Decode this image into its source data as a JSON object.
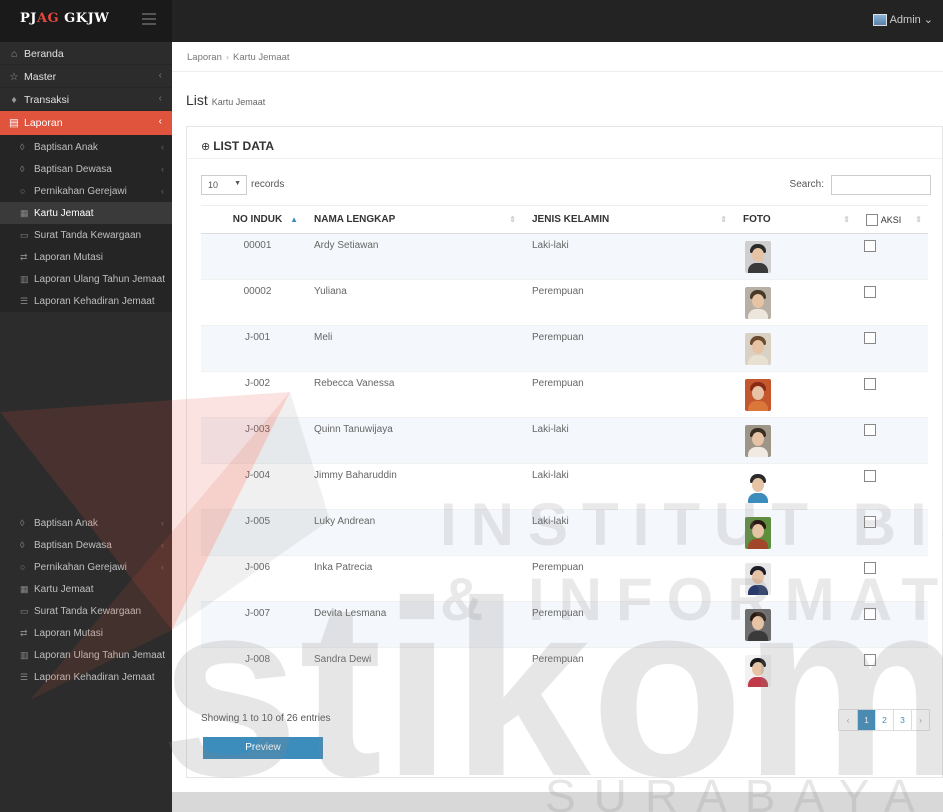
{
  "app": {
    "brand_prefix": "PJ",
    "brand_accent": "AG",
    "brand_suffix": " GKJW",
    "user": "Admin",
    "accent_color": "#e0533d",
    "primary_color": "#3c8dbc"
  },
  "sidebar": {
    "items": [
      {
        "label": "Beranda",
        "icon": "home-icon"
      },
      {
        "label": "Master",
        "icon": "star-icon"
      },
      {
        "label": "Transaksi",
        "icon": "diamond-icon"
      },
      {
        "label": "Laporan",
        "icon": "report-icon"
      }
    ],
    "sub_items": [
      {
        "label": "Baptisan Anak"
      },
      {
        "label": "Baptisan Dewasa"
      },
      {
        "label": "Pernikahan Gerejawi"
      },
      {
        "label": "Kartu Jemaat"
      },
      {
        "label": "Surat Tanda Kewargaan"
      },
      {
        "label": "Laporan Mutasi"
      },
      {
        "label": "Laporan Ulang Tahun Jemaat"
      },
      {
        "label": "Laporan Kehadiran Jemaat"
      }
    ]
  },
  "breadcrumb": {
    "parent": "Laporan",
    "current": "Kartu Jemaat"
  },
  "page": {
    "title": "List",
    "subtitle": "Kartu Jemaat"
  },
  "box": {
    "title": "LIST DATA"
  },
  "controls": {
    "length_value": "10",
    "length_label": "records",
    "search_label": "Search:",
    "search_value": ""
  },
  "table": {
    "headers": {
      "no": "NO INDUK",
      "name": "NAMA LENGKAP",
      "gender": "JENIS KELAMIN",
      "photo": "FOTO",
      "action": "AKSI"
    },
    "rows": [
      {
        "no": "00001",
        "name": "Ardy Setiawan",
        "gender": "Laki-laki"
      },
      {
        "no": "00002",
        "name": "Yuliana",
        "gender": "Perempuan"
      },
      {
        "no": "J-001",
        "name": "Meli",
        "gender": "Perempuan"
      },
      {
        "no": "J-002",
        "name": "Rebecca Vanessa",
        "gender": "Perempuan"
      },
      {
        "no": "J-003",
        "name": "Quinn Tanuwijaya",
        "gender": "Laki-laki"
      },
      {
        "no": "J-004",
        "name": "Jimmy Baharuddin",
        "gender": "Laki-laki"
      },
      {
        "no": "J-005",
        "name": "Luky Andrean",
        "gender": "Laki-laki"
      },
      {
        "no": "J-006",
        "name": "Inka Patrecia",
        "gender": "Perempuan"
      },
      {
        "no": "J-007",
        "name": "Devita Lesmana",
        "gender": "Perempuan"
      },
      {
        "no": "J-008",
        "name": "Sandra Dewi",
        "gender": "Perempuan"
      }
    ]
  },
  "footer": {
    "info": "Showing 1 to 10 of 26 entries",
    "pages": [
      "‹",
      "1",
      "2",
      "3",
      "›"
    ],
    "current_page": "1",
    "preview_label": "Preview"
  },
  "watermark": {
    "line1": "INSTITUT BISNIS",
    "line2": "& INFORMATIKA",
    "line3": "stikom",
    "line4": "SURABAYA"
  }
}
